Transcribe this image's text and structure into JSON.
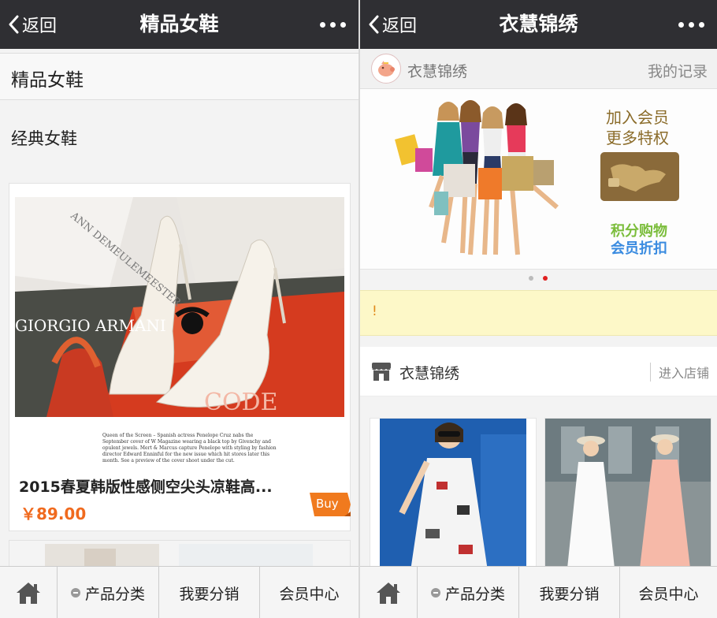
{
  "left": {
    "nav": {
      "back_label": "返回",
      "title": "精品女鞋"
    },
    "category_title": "精品女鞋",
    "section_title": "经典女鞋",
    "product": {
      "name": "2015春夏韩版性感侧空尖头凉鞋高...",
      "price": "￥89.00",
      "buy_label": "Buy",
      "magazine_caption": "Queen of the Screen – Spanish actress Penelope Cruz nabs the September cover of W Magazine wearing a black top by Givenchy and opulent jewels. Mert & Marcus capture Penelope with styling by fashion director Edward Enninful for the new issue which hit stores later this month. See a preview of the cover shoot under the cut.",
      "box_text": "ANN DEMEULEMEESTER",
      "mag_text": "GIORGIO ARMANI",
      "mag_text2": "CODE"
    }
  },
  "right": {
    "nav": {
      "back_label": "返回",
      "title": "衣慧锦绣"
    },
    "store_name": "衣慧锦绣",
    "records_label": "我的记录",
    "banner": {
      "line1": "加入会员",
      "line2": "更多特权",
      "line3": "积分购物",
      "line4": "会员折扣"
    },
    "notice": "!",
    "shop": {
      "name": "衣慧锦绣",
      "enter_label": "进入店铺"
    }
  },
  "tabbar": {
    "category_label": "产品分类",
    "distribute_label": "我要分销",
    "member_label": "会员中心"
  },
  "colors": {
    "topbar": "#2f2f33",
    "price": "#f06a1e",
    "buy_tag": "#f07a1e",
    "active_dot": "#e02020",
    "notice_bg": "#fdf8c8"
  }
}
